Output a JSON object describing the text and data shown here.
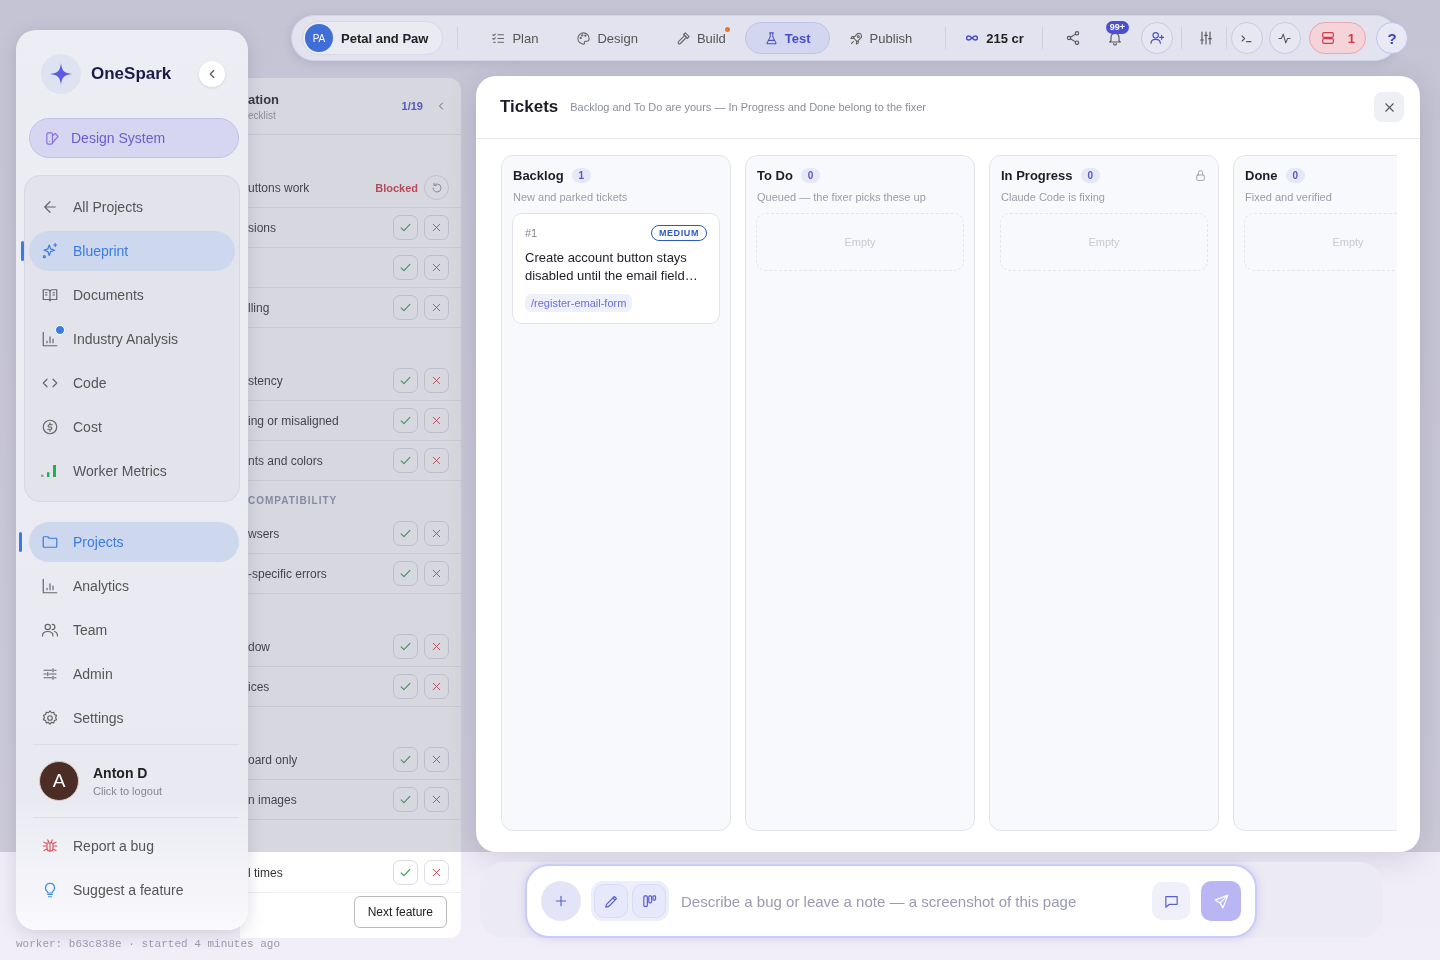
{
  "topbar": {
    "project": {
      "initials": "PA",
      "name": "Petal and Paw"
    },
    "tabs": [
      {
        "label": "Plan",
        "selected": false,
        "has_update": false
      },
      {
        "label": "Design",
        "selected": false,
        "has_update": false
      },
      {
        "label": "Build",
        "selected": false,
        "has_update": true
      },
      {
        "label": "Test",
        "selected": true,
        "has_update": false
      },
      {
        "label": "Publish",
        "selected": false,
        "has_update": false
      }
    ],
    "credits": "215 cr",
    "notifications_badge": "99+",
    "alerts_count": "1",
    "help": "?"
  },
  "sidebar": {
    "brand": "OneSpark",
    "workspace": "Design System",
    "project_nav": [
      {
        "label": "All Projects",
        "selected": false,
        "dot": false
      },
      {
        "label": "Blueprint",
        "selected": true,
        "dot": false
      },
      {
        "label": "Documents",
        "selected": false,
        "dot": false
      },
      {
        "label": "Industry Analysis",
        "selected": false,
        "dot": true
      },
      {
        "label": "Code",
        "selected": false,
        "dot": false
      },
      {
        "label": "Cost",
        "selected": false,
        "dot": false
      },
      {
        "label": "Worker Metrics",
        "selected": false,
        "dot": false
      }
    ],
    "main_nav": [
      {
        "label": "Projects",
        "selected": true
      },
      {
        "label": "Analytics",
        "selected": false
      },
      {
        "label": "Team",
        "selected": false
      },
      {
        "label": "Admin",
        "selected": false
      },
      {
        "label": "Settings",
        "selected": false
      }
    ],
    "user": {
      "initial": "A",
      "name": "Anton D",
      "hint": "Click to logout"
    },
    "feedback": [
      {
        "label": "Report a bug"
      },
      {
        "label": "Suggest a feature"
      }
    ]
  },
  "checklist": {
    "title": "ation",
    "subtitle": "ecklist",
    "progress": "1/19",
    "sections": [
      {
        "rows": [
          {
            "label": "uttons work",
            "kind": "blocked",
            "status": "Blocked"
          },
          {
            "label": "sions",
            "kind": "check"
          },
          {
            "kind": "check"
          },
          {
            "label": "lling",
            "kind": "check"
          }
        ]
      },
      {
        "rows": [
          {
            "label": "stency",
            "kind": "check"
          },
          {
            "label": "ing or misaligned",
            "kind": "check"
          },
          {
            "label": "nts and colors",
            "kind": "check"
          }
        ]
      },
      {
        "heading": "COMPATIBILITY",
        "rows": [
          {
            "label": "wsers",
            "kind": "check"
          },
          {
            "label": "-specific errors",
            "kind": "check"
          }
        ]
      },
      {
        "rows": [
          {
            "label": "dow",
            "kind": "check"
          },
          {
            "label": "ices",
            "kind": "check"
          }
        ]
      },
      {
        "rows": [
          {
            "label": "oard only",
            "kind": "check"
          },
          {
            "label": "n images",
            "kind": "check"
          }
        ]
      },
      {
        "rows": [
          {
            "label": "l times",
            "kind": "check"
          }
        ]
      }
    ],
    "next_button": "Next feature"
  },
  "tickets": {
    "title": "Tickets",
    "subtitle": "Backlog and To Do are yours — In Progress and Done belong to the fixer",
    "columns": [
      {
        "name": "Backlog",
        "count": "1",
        "description": "New and parked tickets",
        "locked": false,
        "tickets": [
          {
            "number": "#1",
            "priority": "MEDIUM",
            "title": "Create account button stays disabled until the email field…",
            "route": "/register-email-form"
          }
        ]
      },
      {
        "name": "To Do",
        "count": "0",
        "description": "Queued — the fixer picks these up",
        "locked": false,
        "empty_label": "Empty"
      },
      {
        "name": "In Progress",
        "count": "0",
        "description": "Claude Code is fixing",
        "locked": true,
        "empty_label": "Empty"
      },
      {
        "name": "Done",
        "count": "0",
        "description": "Fixed and verified",
        "locked": false,
        "empty_label": "Empty"
      }
    ]
  },
  "composer": {
    "placeholder": "Describe a bug or leave a note — a screenshot of this page"
  },
  "footer": "worker: b63c838e · started 4 minutes ago"
}
